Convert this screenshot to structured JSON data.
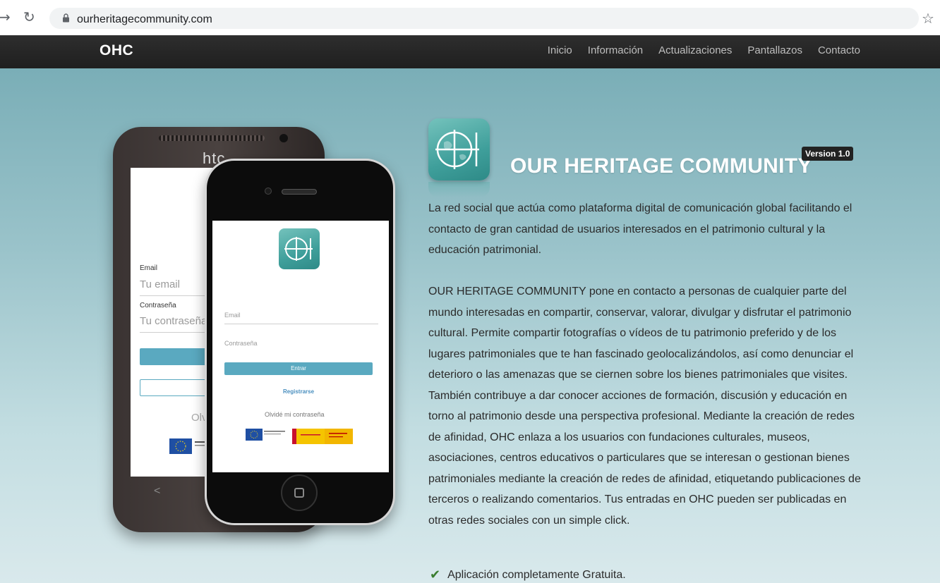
{
  "browser": {
    "back_icon": "arrow-right-icon",
    "reload_icon": "reload-icon",
    "url": "ourheritagecommunity.com",
    "bookmark_icon": "star-icon"
  },
  "nav": {
    "brand": "OHC",
    "items": [
      "Inicio",
      "Información",
      "Actualizaciones",
      "Pantallazos",
      "Contacto"
    ]
  },
  "hero": {
    "title": "OUR HERITAGE COMMUNITY",
    "version": "Version 1.0",
    "paragraph1": "La red social que actúa como plataforma digital de comunicación global facilitando el contacto de gran cantidad de usuarios interesados en el patrimonio cultural y la educación patrimonial.",
    "paragraph2": "OUR HERITAGE COMMUNITY pone en contacto a personas de cualquier parte del mundo interesadas en compartir, conservar, valorar, divulgar y disfrutar el patrimonio cultural. Permite compartir fotografías o vídeos de tu patrimonio preferido y de los lugares patrimoniales que te han fascinado geolocalizándolos, así como denunciar el deterioro o las amenazas que se ciernen sobre los bienes patrimoniales que visites. También contribuye a dar conocer acciones de formación, discusión y educación en torno al patrimonio desde una perspectiva profesional. Mediante la creación de redes de afinidad, OHC enlaza a los usuarios con fundaciones culturales, museos, asociaciones, centros educativos o particulares que se interesan o gestionan bienes patrimoniales mediante la creación de redes de afinidad, etiquetando publicaciones de terceros o realizando comentarios. Tus entradas en OHC pueden ser publicadas en otras redes sociales con un simple click.",
    "feature": "Aplicación completamente Gratuita."
  },
  "htc_phone": {
    "brand": "htc",
    "email_label": "Email",
    "email_placeholder": "Tu email",
    "password_label": "Contraseña",
    "password_placeholder": "Tu contraseña",
    "forgot_partial": "Olv",
    "back_glyph": "<"
  },
  "iphone": {
    "email_placeholder": "Email",
    "password_placeholder": "Contraseña",
    "login_button": "Entrar",
    "register_link": "Registrarse",
    "forgot_link": "Olvidé mi contraseña"
  },
  "colors": {
    "navbar": "#262626",
    "accent": "#5aa9c0",
    "hero_top": "#7aaeb7",
    "hero_bottom": "#d9e9ec"
  }
}
